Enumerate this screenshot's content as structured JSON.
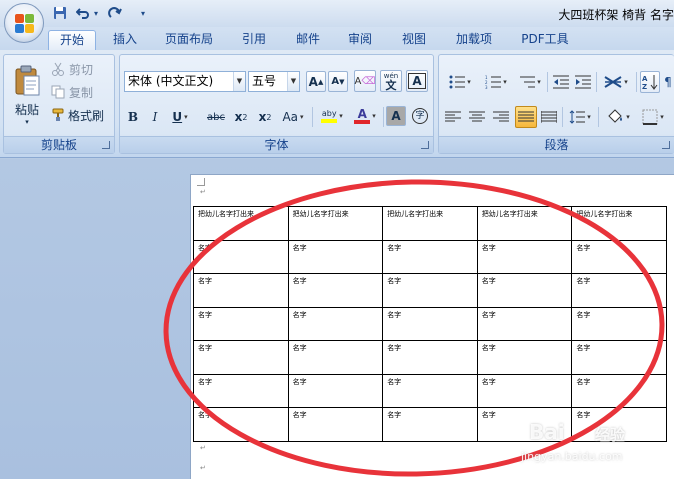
{
  "window": {
    "title": "大四班杯架 椅背 名字"
  },
  "quick_access": {
    "undo_dropdown": "▾",
    "customize": "▾"
  },
  "tabs": [
    {
      "label": "开始",
      "active": true
    },
    {
      "label": "插入"
    },
    {
      "label": "页面布局"
    },
    {
      "label": "引用"
    },
    {
      "label": "邮件"
    },
    {
      "label": "审阅"
    },
    {
      "label": "视图"
    },
    {
      "label": "加载项"
    },
    {
      "label": "PDF工具"
    }
  ],
  "clipboard": {
    "label": "剪贴板",
    "paste": "粘贴",
    "cut": "剪切",
    "copy": "复制",
    "format_painter": "格式刷"
  },
  "font": {
    "label": "字体",
    "font_name": "宋体 (中文正文)",
    "font_size": "五号",
    "grow": "A",
    "shrink": "A",
    "clear": "A",
    "phonetic": "wén",
    "phonetic_char": "文",
    "border_char": "A",
    "bold": "B",
    "italic": "I",
    "underline": "U",
    "strike": "abc",
    "subscript": "x",
    "superscript": "x",
    "sub_mark": "2",
    "sup_mark": "2",
    "change_case": "Aa",
    "highlight_text": "aby",
    "font_color_char": "A",
    "shading_char": "A",
    "enclose_char": "字"
  },
  "paragraph": {
    "label": "段落"
  },
  "document": {
    "table": {
      "header_row": [
        "把幼儿名字打出来",
        "把幼儿名字打出来",
        "把幼儿名字打出来",
        "把幼儿名字打出来",
        "把幼儿名字打出来"
      ],
      "body_rows": [
        [
          "名字",
          "名字",
          "名字",
          "名字",
          "名字"
        ],
        [
          "名字",
          "名字",
          "名字",
          "名字",
          "名字"
        ],
        [
          "名字",
          "名字",
          "名字",
          "名字",
          "名字"
        ],
        [
          "名字",
          "名字",
          "名字",
          "名字",
          "名字"
        ],
        [
          "名字",
          "名字",
          "名字",
          "名字",
          "名字"
        ],
        [
          "名字",
          "名字",
          "名字",
          "名字",
          "名字"
        ]
      ]
    },
    "paragraph_mark": "↵"
  },
  "watermark": {
    "brand": "Bai",
    "sub": "经验",
    "url": "jingyan.baidu.com"
  },
  "colors": {
    "annotation_circle": "#e8333a",
    "highlight_yellow": "#ffff00",
    "font_color_red": "#e0262a"
  }
}
